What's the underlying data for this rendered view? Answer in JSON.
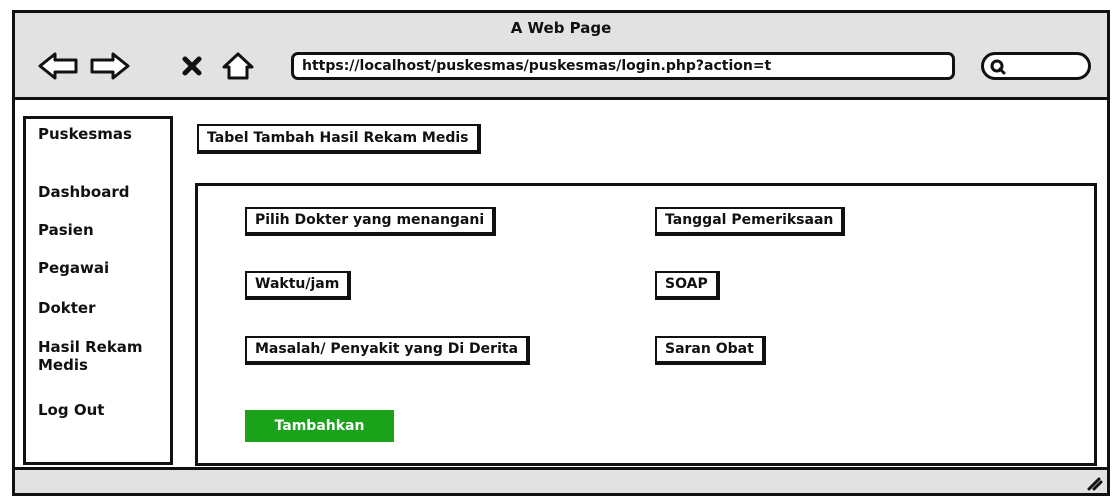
{
  "window": {
    "title": "A Web Page"
  },
  "toolbar": {
    "url": "https://localhost/puskesmas/puskesmas/login.php?action=t",
    "icons": [
      "back-arrow-icon",
      "forward-arrow-icon",
      "close-icon",
      "home-icon",
      "search-icon"
    ]
  },
  "sidebar": {
    "title": "Puskesmas",
    "items": [
      {
        "label": "Dashboard"
      },
      {
        "label": "Pasien"
      },
      {
        "label": "Pegawai"
      },
      {
        "label": "Dokter"
      },
      {
        "label": "Hasil Rekam Medis"
      },
      {
        "label": "Log Out"
      }
    ]
  },
  "main": {
    "heading": "Tabel Tambah Hasil Rekam Medis",
    "fields": {
      "dokter": "Pilih Dokter yang menangani",
      "tanggal": "Tanggal Pemeriksaan",
      "waktu": "Waktu/jam",
      "soap": "SOAP",
      "masalah": "Masalah/ Penyakit yang Di Derita",
      "saran": "Saran Obat"
    },
    "submit_label": "Tambahkan"
  },
  "colors": {
    "frame": "#e2e2e2",
    "accent": "#1aa31a",
    "stroke": "#111111"
  }
}
